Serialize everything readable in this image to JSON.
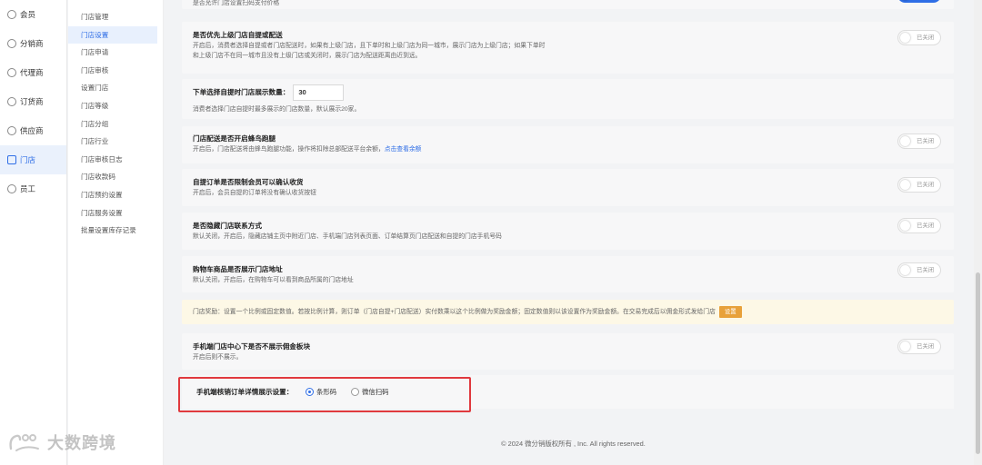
{
  "sidebar_primary": [
    {
      "label": "会员",
      "icon": "user-icon"
    },
    {
      "label": "分销商",
      "icon": "share-icon"
    },
    {
      "label": "代理商",
      "icon": "agent-icon"
    },
    {
      "label": "订货商",
      "icon": "order-icon"
    },
    {
      "label": "供应商",
      "icon": "supplier-icon"
    },
    {
      "label": "门店",
      "icon": "store-icon",
      "active": true
    },
    {
      "label": "员工",
      "icon": "staff-icon"
    }
  ],
  "sidebar_secondary": [
    {
      "label": "门店管理"
    },
    {
      "label": "门店设置",
      "active": true
    },
    {
      "label": "门店申请"
    },
    {
      "label": "门店审核"
    },
    {
      "label": "设置门店"
    },
    {
      "label": "门店等级"
    },
    {
      "label": "门店分组"
    },
    {
      "label": "门店行业"
    },
    {
      "label": "门店审核日志"
    },
    {
      "label": "门店收款码"
    },
    {
      "label": "门店预约设置"
    },
    {
      "label": "门店服务设置"
    },
    {
      "label": "批量设置库存记录"
    }
  ],
  "top_fragment": "是否允许门店设置扫码支付价格",
  "settings": {
    "priority": {
      "title": "是否优先上级门店自提或配送",
      "desc1": "开启后，消费者选择自提或者门店配送时，如果有上级门店，且下单时和上级门店为同一城市，展示门店为上级门店；如果下单时",
      "desc2": "和上级门店不在同一城市且没有上级门店或关闭时，展示门店为配送距离由近到远。",
      "toggle": "已关闭"
    },
    "pickup_count": {
      "title": "下单选择自提时门店展示数量：",
      "value": "30",
      "desc": "消费者选择门店自提时最多展示的门店数量，默认展示20家。"
    },
    "fengniao": {
      "title": "门店配送是否开启蜂鸟跑腿",
      "desc": "开启后，门店配送将由蜂鸟跑腿功能，操作将扣除总部配送平台余额，",
      "link": "点击查看余额",
      "toggle": "已关闭"
    },
    "pickup_confirm": {
      "title": "自提订单是否限制会员可以确认收货",
      "desc": "开启后，会员自提的订单将没有确认收货按钮",
      "toggle": "已关闭"
    },
    "hide_contact": {
      "title": "是否隐藏门店联系方式",
      "desc": "默认关闭，开启后，隐藏店铺主页中附近门店、手机端门店列表页面、订单结算页门店配送和自提的门店手机号码",
      "toggle": "已关闭"
    },
    "cart_address": {
      "title": "购物车商品是否展示门店地址",
      "desc": "默认关闭，开启后，在购物车可以看到商品所属的门店地址",
      "toggle": "已关闭"
    },
    "reward_notice": {
      "text": "门店奖励：设置一个比例或固定数值。若按比例计算，则订单（门店自提+门店配送）实付数乘以这个比例做为奖励金额；固定数值则以该设置作为奖励金额。在交易完成后以佣金形式发给门店",
      "button": "设置"
    },
    "mobile_commission": {
      "title": "手机端门店中心下是否不展示佣金板块",
      "desc": "开启后则不展示。",
      "toggle": "已关闭"
    },
    "verify_display": {
      "label": "手机端核销订单详情展示设置：",
      "options": [
        "条形码",
        "微信扫码"
      ],
      "selected": "条形码"
    }
  },
  "footer": "© 2024 微分销版权所有 , Inc. All rights reserved.",
  "watermark": "大数跨境",
  "colors": {
    "accent": "#2f6ee6",
    "highlight": "#e0393e",
    "notice_bg": "#fdf8e6",
    "notice_btn": "#e8a13a"
  }
}
